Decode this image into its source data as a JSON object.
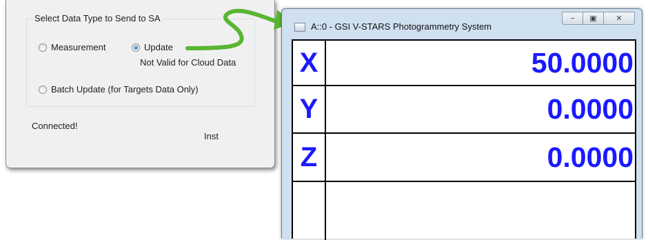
{
  "dialog": {
    "group_title": "Select Data Type to Send to SA",
    "options": {
      "measurement": "Measurement",
      "update": "Update",
      "batch_update": "Batch Update (for Targets Data Only)"
    },
    "selected": "update",
    "cloud_note": "Not Valid for Cloud Data",
    "status": "Connected!",
    "inst_label": "Inst"
  },
  "window": {
    "title": "A::0 - GSI V-STARS Photogrammetry System",
    "caption_buttons": [
      "minimize-icon",
      "restore-icon",
      "close-icon"
    ]
  },
  "readout": {
    "rows": [
      {
        "axis": "X",
        "value": "50.0000"
      },
      {
        "axis": "Y",
        "value": "0.0000"
      },
      {
        "axis": "Z",
        "value": "0.0000"
      },
      {
        "axis": "",
        "value": ""
      }
    ]
  },
  "colors": {
    "readout_text": "#1a1aff",
    "arrow": "#5ab532",
    "dialog_bg": "#f0f0f0",
    "window_frame": "#cfe0f1"
  }
}
